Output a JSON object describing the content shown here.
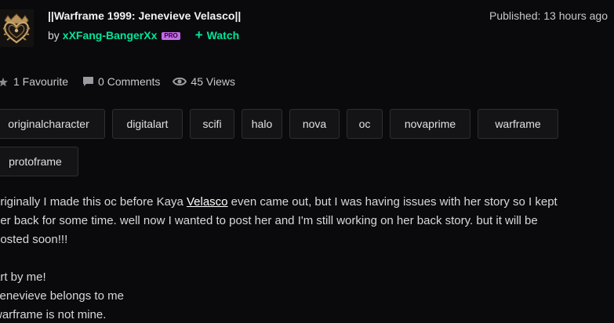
{
  "deviation": {
    "title": "||Warframe 1999: Jenevieve Velasco||",
    "by_prefix": "by",
    "author": "xXFang-BangerXx",
    "badge": "PRO",
    "watch_label": "Watch",
    "published": "Published: 13 hours ago"
  },
  "stats": {
    "favourites": "1 Favourite",
    "comments": "0 Comments",
    "views": "45 Views"
  },
  "tags": [
    "originalcharacter",
    "digitalart",
    "scifi",
    "halo",
    "nova",
    "oc",
    "novaprime",
    "warframe",
    "protoframe"
  ],
  "description": {
    "line1_before": "originally I made this oc before Kaya ",
    "line1_link": "Velasco",
    "line1_after": " even came out, but I was having issues with her story so I kept",
    "line2": "her back for some time. well now I wanted to post her and I'm still working on her back story. but it will be",
    "line3": "posted soon!!!",
    "line4": "art by me!",
    "line5": "Jenevieve belongs to me",
    "line6": "warframe is not mine."
  },
  "colors": {
    "background": "#0a0a0c",
    "accent": "#00e59b",
    "pro_badge": "#c36ae6",
    "tag_bg": "#141417",
    "tag_border": "#2e2e34"
  },
  "icons": {
    "avatar": "gold-heart-crest-avatar",
    "favourite": "star-icon",
    "comments": "comment-bubble-icon",
    "views": "eye-icon",
    "watch": "plus-icon"
  }
}
